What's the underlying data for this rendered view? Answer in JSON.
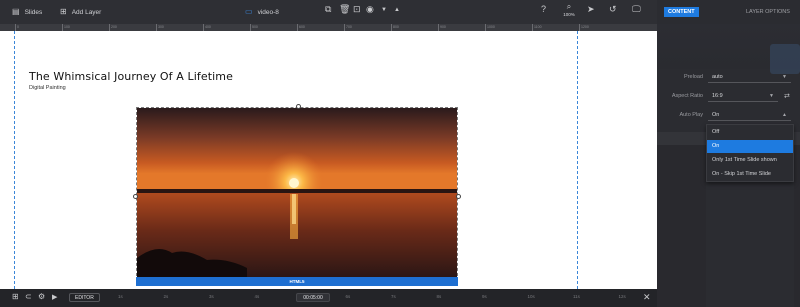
{
  "toolbar": {
    "slides_label": "Slides",
    "add_layer_label": "Add Layer",
    "layer_name": "video-8",
    "zoom": "100%"
  },
  "ruler": [
    "0",
    "100",
    "200",
    "300",
    "400",
    "500",
    "600",
    "700",
    "800",
    "900",
    "1000",
    "1100",
    "1200"
  ],
  "slide": {
    "title": "The Whimsical Journey Of A Lifetime",
    "subtitle": "Digital Painting",
    "video_badge": "HTML5"
  },
  "timeline": {
    "editor_label": "EDITOR",
    "time": "00:05:00",
    "ticks": [
      "1s",
      "2s",
      "3s",
      "4s",
      "5s",
      "6s",
      "7s",
      "8s",
      "9s",
      "10s",
      "11s",
      "12s"
    ]
  },
  "panel": {
    "tab_content": "CONTENT",
    "tab_layer_options": "LAYER OPTIONS",
    "preload_label": "Preload",
    "preload_value": "auto",
    "aspect_label": "Aspect Ratio",
    "aspect_value": "16:9",
    "autoplay_label": "Auto Play",
    "autoplay_value": "On",
    "autoplay_options": [
      "Off",
      "On",
      "Only 1st Time Slide shown",
      "On - Skip 1st Time Slide"
    ],
    "autoplay_selected_index": 1
  },
  "colors": {
    "accent": "#1e7be0",
    "guide": "#3b86d8"
  }
}
